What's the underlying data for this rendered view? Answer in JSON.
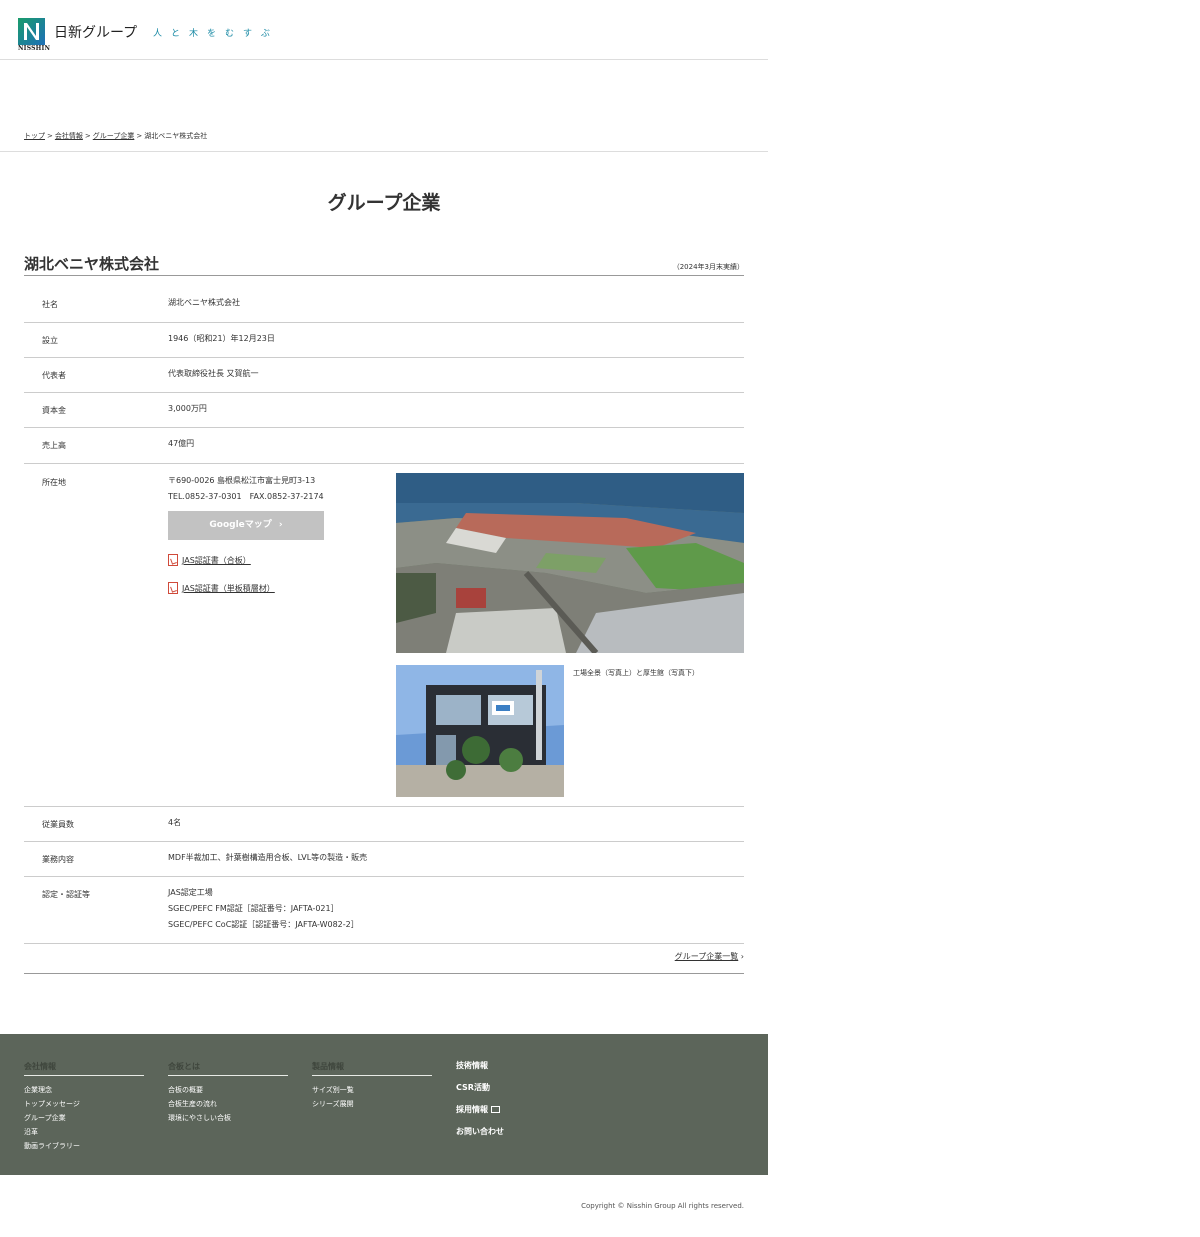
{
  "header": {
    "logo_sub": "NISSHIN",
    "logo_text": "日新グループ",
    "tagline": "人と木をむすぶ"
  },
  "breadcrumb": [
    {
      "label": "トップ",
      "link": true
    },
    {
      "label": "会社情報",
      "link": true
    },
    {
      "label": "グループ企業",
      "link": true
    },
    {
      "label": "湖北ベニヤ株式会社",
      "link": false
    }
  ],
  "breadcrumb_sep": ">",
  "page_title": "グループ企業",
  "company": {
    "name": "湖北ベニヤ株式会社",
    "fiscal_note": "（2024年3月末実績）"
  },
  "table": {
    "company_name": {
      "label": "社名",
      "value": "湖北ベニヤ株式会社"
    },
    "established": {
      "label": "設立",
      "value": "1946（昭和21）年12月23日"
    },
    "representative": {
      "label": "代表者",
      "value": "代表取締役社長 又賀航一"
    },
    "capital": {
      "label": "資本金",
      "value": "3,000万円"
    },
    "sales": {
      "label": "売上高",
      "value": "47億円"
    },
    "address": {
      "label": "所在地",
      "line1": "〒690-0026 島根県松江市富士見町3-13",
      "line2": "TEL.0852-37-0301　FAX.0852-37-2174",
      "map_button": "Googleマップ",
      "pdf1": "JAS認証書（合板）",
      "pdf2": "JAS認証書（単板積層材）",
      "photo_caption": "工場全景（写真上）と厚生館（写真下）"
    },
    "employees": {
      "label": "従業員数",
      "value": "4名"
    },
    "business": {
      "label": "業務内容",
      "value": "MDF半裁加工、針葉樹構造用合板、LVL等の製造・販売"
    },
    "certification": {
      "label": "認定・認証等",
      "lines": [
        "JAS認定工場",
        "SGEC/PEFC FM認証［認証番号：JAFTA-021］",
        "SGEC/PEFC CoC認証［認証番号：JAFTA-W082-2］"
      ]
    }
  },
  "group_list_link": "グループ企業一覧",
  "footer": {
    "columns": [
      {
        "heading": "会社情報",
        "items": [
          "企業理念",
          "トップメッセージ",
          "グループ企業",
          "沿革",
          "動画ライブラリー"
        ]
      },
      {
        "heading": "合板とは",
        "items": [
          "合板の概要",
          "合板生産の流れ",
          "環境にやさしい合板"
        ]
      },
      {
        "heading": "製品情報",
        "items": [
          "サイズ別一覧",
          "シリーズ展開"
        ]
      }
    ],
    "links": [
      "技術情報",
      "CSR活動",
      "採用情報",
      "お問い合わせ"
    ]
  },
  "copyright": "Copyright © Nisshin Group All rights reserved.",
  "colors": {
    "footer_bg": "#5c655a",
    "map_button_bg": "#c2c2c2",
    "tagline": "#1a8aa5",
    "pdf_icon": "#d04a3a"
  }
}
